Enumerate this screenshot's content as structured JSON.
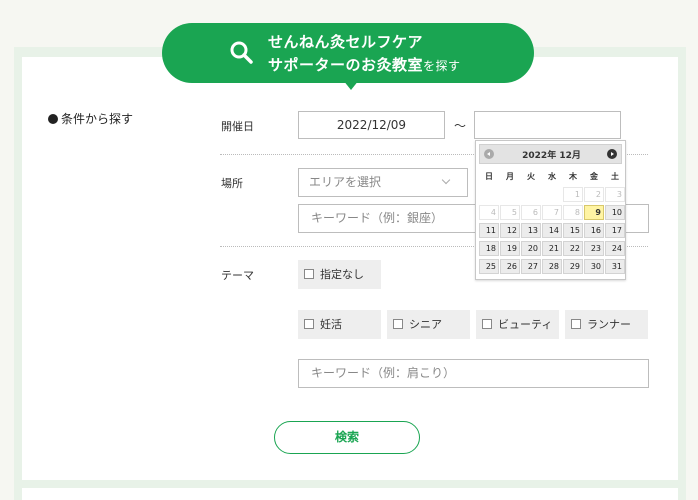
{
  "banner": {
    "line1": "せんねん灸セルフケア",
    "line2_main": "サポーターのお灸教室",
    "line2_small": "を探す"
  },
  "conditions_label": "条件から探す",
  "date": {
    "label": "開催日",
    "from_value": "2022/12/09",
    "separator": "～",
    "to_value": ""
  },
  "place": {
    "label": "場所",
    "area_select": "エリアを選択",
    "keyword_placeholder": "キーワード（例：銀座）"
  },
  "theme": {
    "label": "テーマ",
    "options": [
      "指定なし",
      "妊活",
      "シニア",
      "ビューティ",
      "ランナー"
    ],
    "keyword_placeholder": "キーワード（例：肩こり）"
  },
  "search_button": "検索",
  "calendar": {
    "title": "2022年 12月",
    "weekdays": [
      "日",
      "月",
      "火",
      "水",
      "木",
      "金",
      "土"
    ],
    "weeks": [
      [
        "",
        "",
        "",
        "",
        "1",
        "2",
        "3"
      ],
      [
        "4",
        "5",
        "6",
        "7",
        "8",
        "9",
        "10"
      ],
      [
        "11",
        "12",
        "13",
        "14",
        "15",
        "16",
        "17"
      ],
      [
        "18",
        "19",
        "20",
        "21",
        "22",
        "23",
        "24"
      ],
      [
        "25",
        "26",
        "27",
        "28",
        "29",
        "30",
        "31"
      ]
    ],
    "today": "9",
    "disabled_before": 9
  },
  "colors": {
    "brand_green": "#1aa552",
    "highlight_yellow": "#fbf0a6",
    "today_yellow": "#fff4a3"
  }
}
